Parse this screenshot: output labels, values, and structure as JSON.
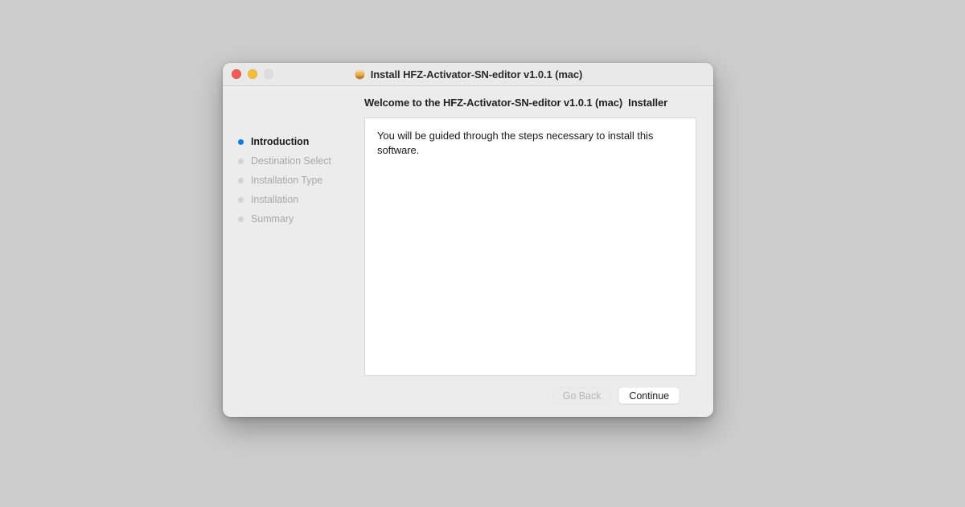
{
  "desktop": {
    "background_color": "#cdcdcd"
  },
  "window": {
    "title": "Install HFZ-Activator-SN-editor v1.0.1 (mac)",
    "icon": "package-installer-icon",
    "traffic_lights": {
      "close_label": "Close",
      "minimize_label": "Minimize",
      "zoom_label": "Zoom",
      "close_color": "#f05b56",
      "minimize_color": "#f6bd3a",
      "zoom_color": "#dedede"
    }
  },
  "sidebar": {
    "active_dot_color": "#0a7cf0",
    "inactive_dot_color": "#d2d2d2",
    "steps": [
      {
        "label": "Introduction",
        "state": "active"
      },
      {
        "label": "Destination Select",
        "state": "pending"
      },
      {
        "label": "Installation Type",
        "state": "pending"
      },
      {
        "label": "Installation",
        "state": "pending"
      },
      {
        "label": "Summary",
        "state": "pending"
      }
    ]
  },
  "main": {
    "heading": "Welcome to the HFZ-Activator-SN-editor v1.0.1 (mac)  Installer",
    "body_text": "You will be guided through the steps necessary to install this software."
  },
  "footer": {
    "go_back_label": "Go Back",
    "continue_label": "Continue"
  }
}
